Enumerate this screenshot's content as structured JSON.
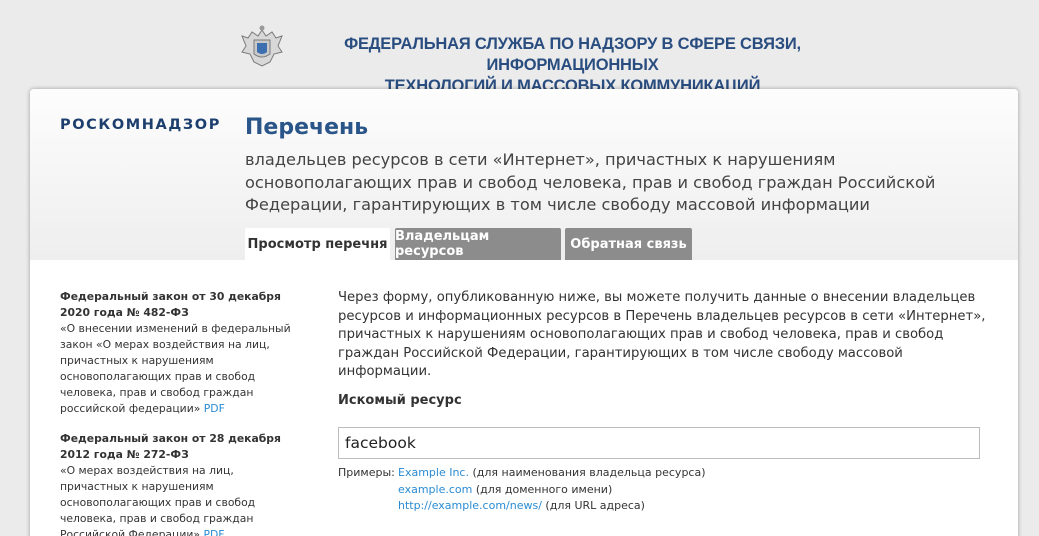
{
  "header": {
    "agency_line1": "ФЕДЕРАЛЬНАЯ СЛУЖБА ПО НАДЗОРУ В СФЕРЕ СВЯЗИ, ИНФОРМАЦИОННЫХ",
    "agency_line2": "ТЕХНОЛОГИЙ И МАССОВЫХ КОММУНИКАЦИЙ"
  },
  "card": {
    "logo": "РОСКОМНАДЗОР",
    "title": "Перечень",
    "subtitle": "владельцев ресурсов в сети «Интернет», причастных к нарушениям основополагающих прав и свобод человека, прав и свобод граждан Российской Федерации, гарантирующих в том числе свободу массовой информации"
  },
  "tabs": [
    {
      "label": "Просмотр перечня",
      "active": true
    },
    {
      "label": "Владельцам ресурсов",
      "active": false
    },
    {
      "label": "Обратная связь",
      "active": false
    }
  ],
  "sidebar": {
    "laws": [
      {
        "title_line1": "Федеральный закон от 30 декабря",
        "title_line2": "2020 года № 482-ФЗ",
        "text": "«О внесении изменений в федеральный закон «О мерах воздействия на лиц, причастных к нарушениям основополагающих прав и свобод человека, прав и свобод граждан российской федерации» ",
        "link": "PDF"
      },
      {
        "title_line1": "Федеральный закон от 28 декабря",
        "title_line2": "2012 года № 272-ФЗ",
        "text": "«О мерах воздействия на лиц, причастных к нарушениям основополагающих прав и свобод человека, прав и свобод граждан Российской Федерации» ",
        "link": "PDF"
      }
    ]
  },
  "main": {
    "intro": "Через форму, опубликованную ниже, вы можете получить данные о внесении владельцев ресурсов и информационных ресурсов в Перечень владельцев ресурсов в сети «Интернет», причастных к нарушениям основополагающих прав и свобод человека, прав и свобод граждан Российской Федерации, гарантирующих в том числе свободу массовой информации.",
    "field_label": "Искомый ресурс",
    "search_value": "facebook",
    "examples_label": "Примеры:",
    "examples": [
      {
        "link": "Example Inc.",
        "note": " (для наименования владельца ресурса)"
      },
      {
        "link": "example.com",
        "note": " (для доменного имени)"
      },
      {
        "link": "http://example.com/news/",
        "note": " (для URL адреса)"
      }
    ]
  },
  "colors": {
    "accent_blue": "#2a5589",
    "link_blue": "#2a8bd2",
    "tab_inactive": "#8c8c8c",
    "background": "#ebebeb"
  }
}
